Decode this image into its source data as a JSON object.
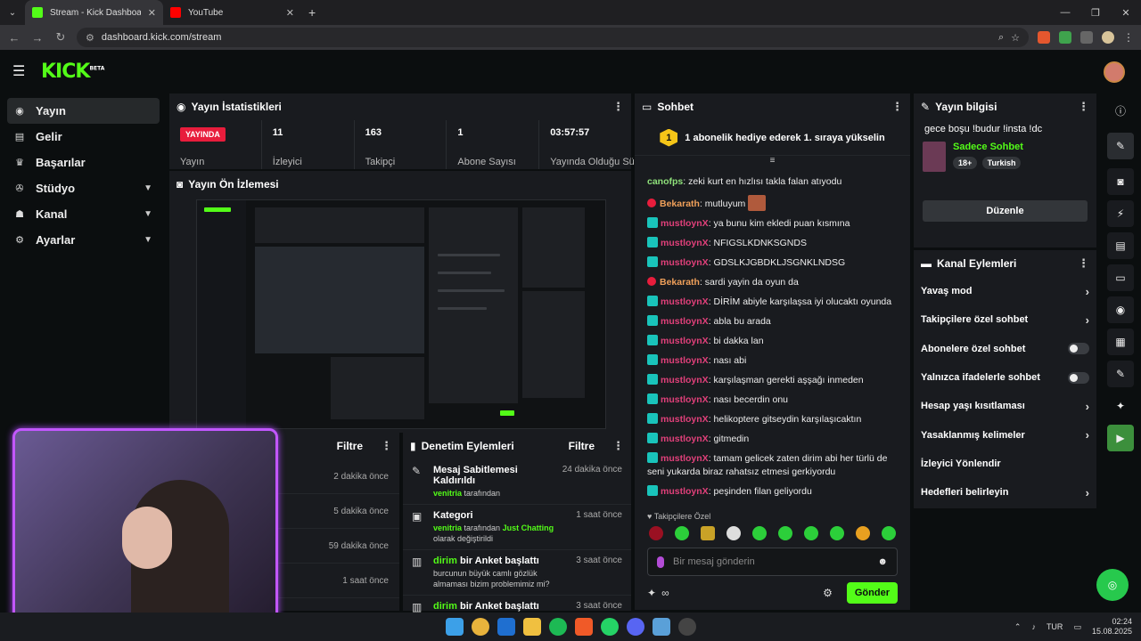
{
  "browser": {
    "tabs": [
      {
        "title": "Stream - Kick Dashboard",
        "color": "#53fc18"
      },
      {
        "title": "YouTube",
        "color": "#ff0000"
      }
    ],
    "url": "dashboard.kick.com/stream"
  },
  "header": {
    "logo": "KICK",
    "logo_tag": "BETA"
  },
  "sidebar": {
    "items": [
      {
        "label": "Yayın",
        "icon": "broadcast-icon"
      },
      {
        "label": "Gelir",
        "icon": "revenue-icon"
      },
      {
        "label": "Başarılar",
        "icon": "trophy-icon"
      },
      {
        "label": "Stüdyo",
        "icon": "studio-icon"
      },
      {
        "label": "Kanal",
        "icon": "channel-icon"
      },
      {
        "label": "Ayarlar",
        "icon": "gear-icon"
      }
    ]
  },
  "stats": {
    "title": "Yayın İstatistikleri",
    "items": [
      {
        "value": "YAYINDA",
        "label": "Yayın"
      },
      {
        "value": "11",
        "label": "İzleyici"
      },
      {
        "value": "163",
        "label": "Takipçi"
      },
      {
        "value": "1",
        "label": "Abone Sayısı"
      },
      {
        "value": "03:57:57",
        "label": "Yayında Olduğu Süre"
      }
    ]
  },
  "preview": {
    "title": "Yayın Ön İzlemesi"
  },
  "recent": {
    "filter": "Filtre",
    "times": [
      "2 dakika önce",
      "5 dakika önce",
      "59 dakika önce",
      "1 saat önce"
    ]
  },
  "moderation": {
    "title": "Denetim Eylemleri",
    "filter": "Filtre",
    "items": [
      {
        "title": "Mesaj Sabitlemesi Kaldırıldı",
        "time": "24 dakika önce",
        "user": "venitria",
        "desc": "tarafından"
      },
      {
        "title": "Kategori",
        "time": "1 saat önce",
        "user": "venitria",
        "desc": "tarafından",
        "target": "Just Chatting",
        "desc2": "olarak değiştirildi"
      },
      {
        "title": "bir Anket başlattı",
        "user": "dirim",
        "time": "3 saat önce",
        "desc": "burcunun büyük camlı gözlük almaması bizim problemimiz mi?"
      },
      {
        "title": "bir Anket başlattı",
        "user": "dirim",
        "time": "3 saat önce"
      }
    ]
  },
  "chat": {
    "title": "Sohbet",
    "gift_banner": "1 abonelik hediye ederek 1. sıraya yükselin",
    "gift_count": "1",
    "messages": [
      {
        "user": "canofps",
        "text": "zeki kurt en hızlısı takla falan atıyodu",
        "color": "#8ee07a",
        "badge": "none"
      },
      {
        "user": "Bekarath",
        "text": "mutluyum",
        "color": "#f0a05a",
        "badge": "red",
        "emote": true
      },
      {
        "user": "mustloynX",
        "text": "ya bunu kim ekledi puan kısmına",
        "color": "#e0407a",
        "badge": "teal"
      },
      {
        "user": "mustloynX",
        "text": "NFIGSLKDNKSGNDS",
        "color": "#e0407a",
        "badge": "teal"
      },
      {
        "user": "mustloynX",
        "text": "GDSLKJGBDKLJSGNKLNDSG",
        "color": "#e0407a",
        "badge": "teal"
      },
      {
        "user": "Bekarath",
        "text": "sardi yayin da oyun da",
        "color": "#f0a05a",
        "badge": "red"
      },
      {
        "user": "mustloynX",
        "text": "DİRİM abiyle karşılaşsa iyi olucaktı oyunda",
        "color": "#e0407a",
        "badge": "teal"
      },
      {
        "user": "mustloynX",
        "text": "abla bu arada",
        "color": "#e0407a",
        "badge": "teal"
      },
      {
        "user": "mustloynX",
        "text": "bi dakka lan",
        "color": "#e0407a",
        "badge": "teal"
      },
      {
        "user": "mustloynX",
        "text": "nası abi",
        "color": "#e0407a",
        "badge": "teal"
      },
      {
        "user": "mustloynX",
        "text": "karşılaşman gerekti aşşağı inmeden",
        "color": "#e0407a",
        "badge": "teal"
      },
      {
        "user": "mustloynX",
        "text": "nası becerdin onu",
        "color": "#e0407a",
        "badge": "teal"
      },
      {
        "user": "mustloynX",
        "text": "helikoptere gitseydin karşılaşıcaktın",
        "color": "#e0407a",
        "badge": "teal"
      },
      {
        "user": "mustloynX",
        "text": "gitmedin",
        "color": "#e0407a",
        "badge": "teal"
      },
      {
        "user": "mustloynX",
        "text": "tamam gelicek zaten dirim abi her türlü de seni yukarda biraz rahatsız etmesi gerkiyordu",
        "color": "#e0407a",
        "badge": "teal"
      },
      {
        "user": "mustloynX",
        "text": "peşinden filan geliyordu",
        "color": "#e0407a",
        "badge": "teal"
      }
    ],
    "follow_only": "Takipçilere Özel",
    "input_placeholder": "Bir mesaj gönderin",
    "send_label": "Gönder"
  },
  "stream_info": {
    "title": "Yayın bilgisi",
    "stream_title": "gece boşu !budur !insta !dc",
    "category": "Sadece Sohbet",
    "tags": [
      "18+",
      "Turkish"
    ],
    "edit_label": "Düzenle"
  },
  "channel_actions": {
    "title": "Kanal Eylemleri",
    "items": [
      {
        "label": "Yavaş mod",
        "type": "chevron"
      },
      {
        "label": "Takipçilere özel sohbet",
        "type": "chevron"
      },
      {
        "label": "Abonelere özel sohbet",
        "type": "toggle"
      },
      {
        "label": "Yalnızca ifadelerle sohbet",
        "type": "toggle"
      },
      {
        "label": "Hesap yaşı kısıtlaması",
        "type": "chevron"
      },
      {
        "label": "Yasaklanmış kelimeler",
        "type": "chevron"
      },
      {
        "label": "İzleyici Yönlendir",
        "type": "none"
      },
      {
        "label": "Hedefleri belirleyin",
        "type": "chevron"
      }
    ]
  },
  "taskbar": {
    "lang": "TUR",
    "time": "02:24",
    "date": "15.08.2025"
  }
}
